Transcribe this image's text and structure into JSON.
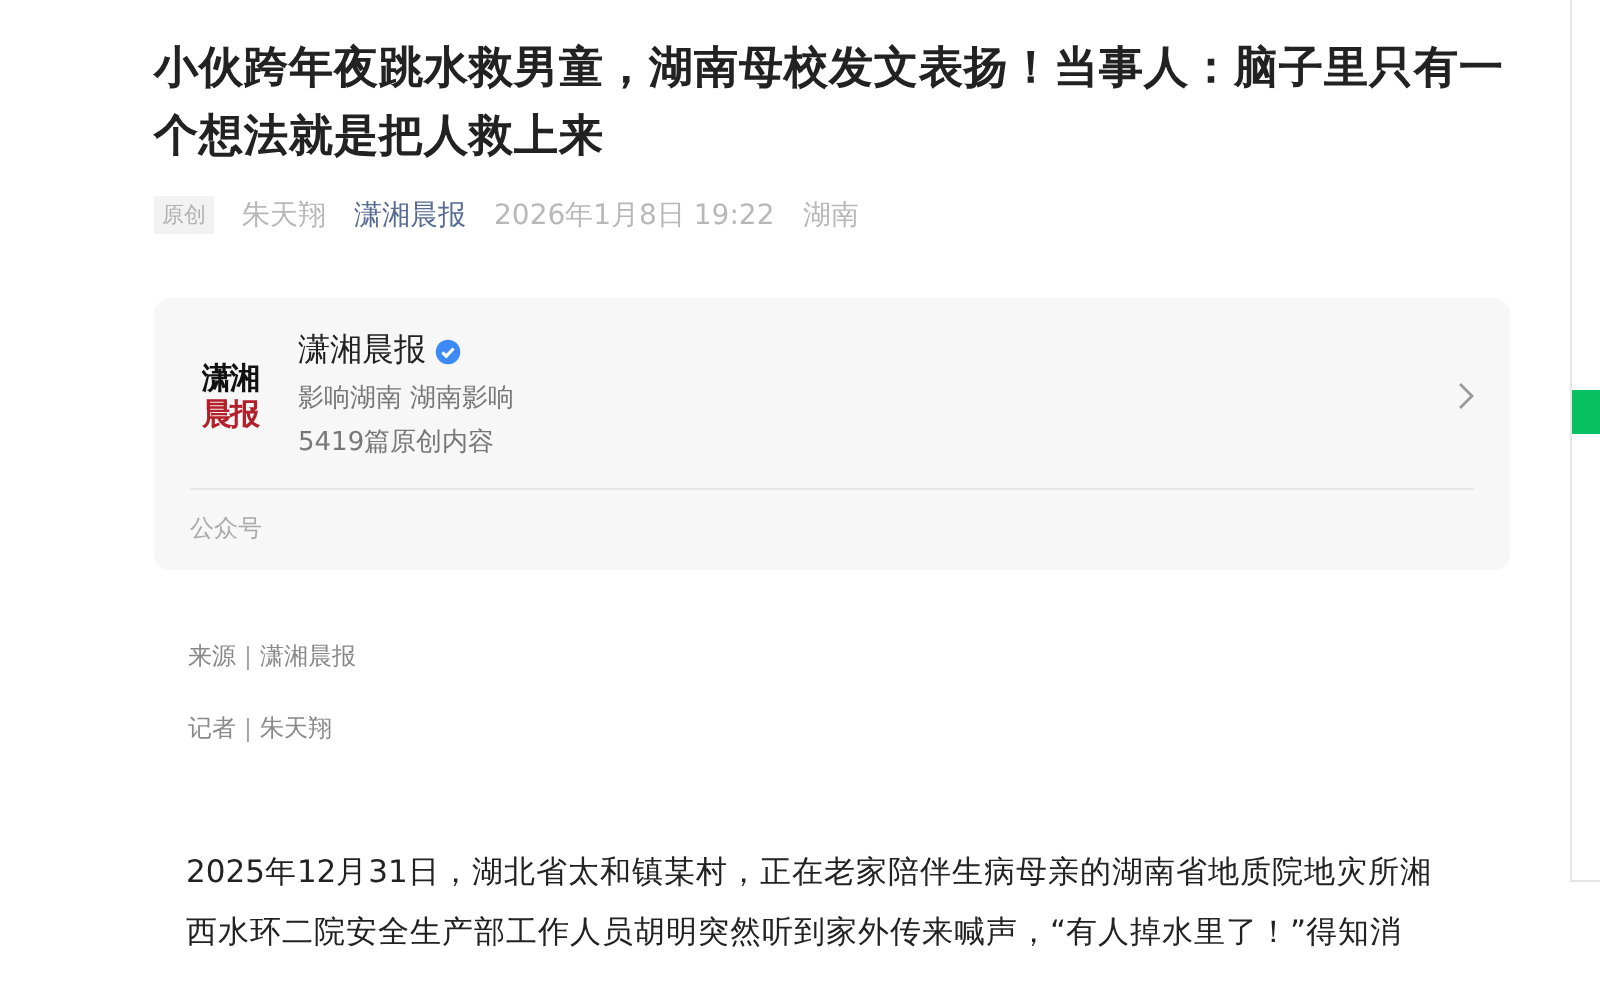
{
  "article": {
    "title": "小伙跨年夜跳水救男童，湖南母校发文表扬！当事人：脑子里只有一个想法就是把人救上来",
    "meta": {
      "badge": "原创",
      "author": "朱天翔",
      "account": "潇湘晨报",
      "date": "2026年1月8日 19:22",
      "location": "湖南"
    }
  },
  "profile_card": {
    "logo_lines": [
      "潇湘",
      "晨报"
    ],
    "name": "潇湘晨报",
    "verified": true,
    "slogan": "影响湖南 湖南影响",
    "count": "5419篇原创内容",
    "footer": "公众号"
  },
  "credits": [
    "来源｜潇湘晨报",
    "记者｜朱天翔"
  ],
  "body": [
    "2025年12月31日，湖北省太和镇某村，正在老家陪伴生病母亲的湖南省地质院地灾所湘",
    "西水环二院安全生产部工作人员胡明突然听到家外传来喊声，“有人掉水里了！”得知消"
  ]
}
